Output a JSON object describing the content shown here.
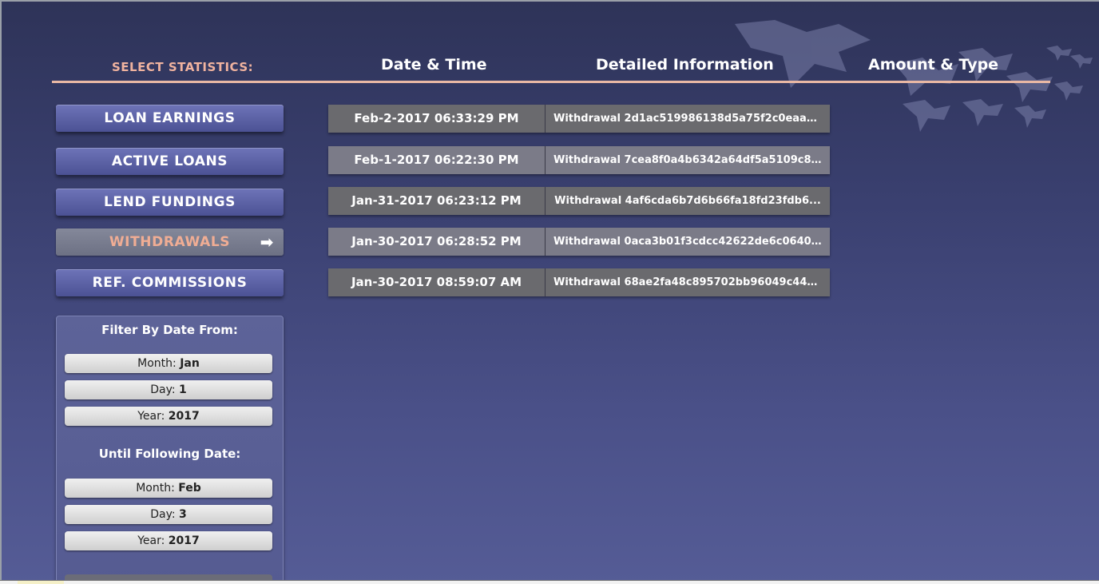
{
  "header": {
    "select_label": "SELECT STATISTICS:",
    "col_date": "Date & Time",
    "col_info": "Detailed Information",
    "col_amount": "Amount & Type"
  },
  "menu": [
    {
      "label": "LOAN EARNINGS",
      "active": false
    },
    {
      "label": "ACTIVE LOANS",
      "active": false
    },
    {
      "label": "LEND FUNDINGS",
      "active": false
    },
    {
      "label": "WITHDRAWALS",
      "active": true,
      "icon": "right-arrow-icon",
      "icon_glyph": "➡"
    },
    {
      "label": "REF. COMMISSIONS",
      "active": false
    }
  ],
  "rows": [
    {
      "date": "Feb-2-2017 06:33:29 PM",
      "info": "Withdrawal 2d1ac519986138d5a75f2c0eaa2..."
    },
    {
      "date": "Feb-1-2017 06:22:30 PM",
      "info": "Withdrawal 7cea8f0a4b6342a64df5a5109c8..."
    },
    {
      "date": "Jan-31-2017 06:23:12 PM",
      "info": "Withdrawal 4af6cda6b7d6b66fa18fd23fdb6..."
    },
    {
      "date": "Jan-30-2017 06:28:52 PM",
      "info": "Withdrawal 0aca3b01f3cdcc42622de6c0640..."
    },
    {
      "date": "Jan-30-2017 08:59:07 AM",
      "info": "Withdrawal 68ae2fa48c895702bb96049c44d..."
    }
  ],
  "filter": {
    "from_title": "Filter By Date From:",
    "until_title": "Until Following Date:",
    "from": {
      "month_label": "Month:",
      "month_value": "Jan",
      "day_label": "Day:",
      "day_value": "1",
      "year_label": "Year:",
      "year_value": "2017"
    },
    "until": {
      "month_label": "Month:",
      "month_value": "Feb",
      "day_label": "Day:",
      "day_value": "3",
      "year_label": "Year:",
      "year_value": "2017"
    }
  },
  "colors": {
    "accent": "#f0b39f",
    "button": "#5b61a5",
    "row": "#6a6a6e"
  }
}
